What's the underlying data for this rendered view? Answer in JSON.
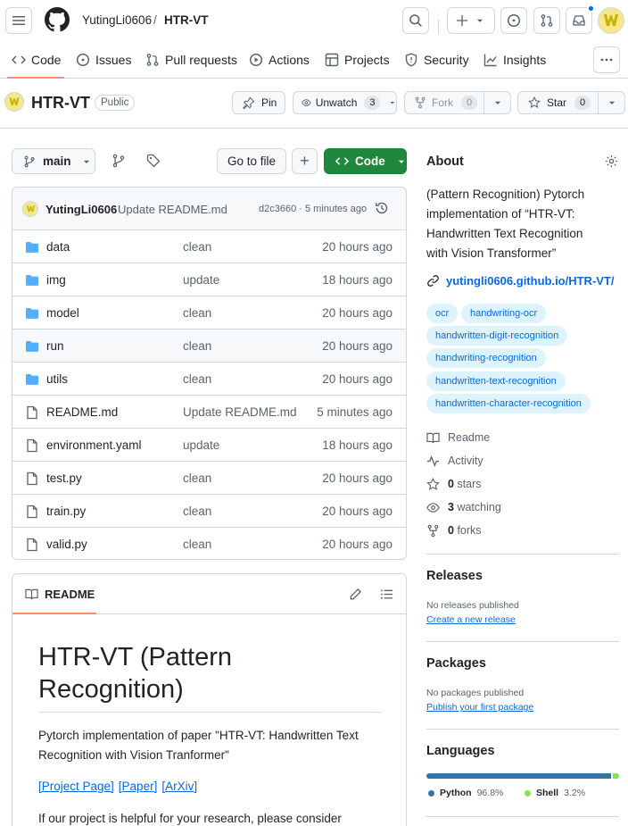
{
  "header": {
    "owner": "YutingLi0606",
    "separator": "/",
    "repo": "HTR-VT"
  },
  "repo_nav": {
    "tabs": [
      {
        "label": "Code",
        "icon": "code-icon"
      },
      {
        "label": "Issues",
        "icon": "issue-icon"
      },
      {
        "label": "Pull requests",
        "icon": "pull-request-icon"
      },
      {
        "label": "Actions",
        "icon": "play-icon"
      },
      {
        "label": "Projects",
        "icon": "table-icon"
      },
      {
        "label": "Security",
        "icon": "shield-icon"
      },
      {
        "label": "Insights",
        "icon": "graph-icon"
      }
    ],
    "active": "Code"
  },
  "repo_title": {
    "name": "HTR-VT",
    "visibility": "Public",
    "pin_label": "Pin",
    "unwatch_label": "Unwatch",
    "unwatch_count": "3",
    "fork_label": "Fork",
    "fork_count": "0",
    "star_label": "Star",
    "star_count": "0"
  },
  "toolbar": {
    "branch": "main",
    "go_to_file": "Go to file",
    "add_label": "+",
    "code_label": "Code"
  },
  "commit": {
    "author": "YutingLi0606",
    "message": "Update README.md",
    "meta": "d2c3660 · 5 minutes ago"
  },
  "files": [
    {
      "name": "data",
      "type": "folder",
      "message": "clean",
      "date": "20 hours ago"
    },
    {
      "name": "img",
      "type": "folder",
      "message": "update",
      "date": "18 hours ago"
    },
    {
      "name": "model",
      "type": "folder",
      "message": "clean",
      "date": "20 hours ago"
    },
    {
      "name": "run",
      "type": "folder",
      "message": "clean",
      "date": "20 hours ago"
    },
    {
      "name": "utils",
      "type": "folder",
      "message": "clean",
      "date": "20 hours ago"
    },
    {
      "name": "README.md",
      "type": "file",
      "message": "Update README.md",
      "date": "5 minutes ago"
    },
    {
      "name": "environment.yaml",
      "type": "file",
      "message": "update",
      "date": "18 hours ago"
    },
    {
      "name": "test.py",
      "type": "file",
      "message": "clean",
      "date": "20 hours ago"
    },
    {
      "name": "train.py",
      "type": "file",
      "message": "clean",
      "date": "20 hours ago"
    },
    {
      "name": "valid.py",
      "type": "file",
      "message": "clean",
      "date": "20 hours ago"
    }
  ],
  "readme": {
    "tab_label": "README",
    "title_line1": "HTR-VT (Pattern",
    "title_line2": "Recognition)",
    "paragraph_line1": "Pytorch implementation of paper \"HTR-VT: Handwritten Text",
    "paragraph_line2": "Recognition with Vision Tranformer\"",
    "links": [
      "[Project Page]",
      "[Paper]",
      "[ArXiv]"
    ],
    "paragraph2": "If our project is helpful for your research, please consider"
  },
  "about": {
    "heading": "About",
    "description_lines": [
      "(Pattern Recognition) Pytorch",
      "implementation of “HTR-VT:",
      "Handwritten Text Recognition",
      "with Vision Transformer”"
    ],
    "website": "yutingli0606.github.io/HTR-VT/",
    "topics": [
      "ocr",
      "handwriting-ocr",
      "handwritten-digit-recognition",
      "handwriting-recognition",
      "handwritten-text-recognition",
      "handwritten-character-recognition"
    ],
    "stats": [
      {
        "icon": "book-icon",
        "bold": "",
        "text": "Readme"
      },
      {
        "icon": "pulse-icon",
        "bold": "",
        "text": "Activity"
      },
      {
        "icon": "star-icon",
        "bold": "0",
        "text": "stars"
      },
      {
        "icon": "eye-icon",
        "bold": "3",
        "text": "watching"
      },
      {
        "icon": "fork-icon",
        "bold": "0",
        "text": "forks"
      }
    ]
  },
  "releases": {
    "heading": "Releases",
    "none_text": "No releases published",
    "create_link": "Create a new release"
  },
  "packages": {
    "heading": "Packages",
    "none_text": "No packages published",
    "publish_link": "Publish your first package"
  },
  "languages": {
    "heading": "Languages",
    "items": [
      {
        "name": "Python",
        "percent": "96.8%",
        "value": 96.8,
        "color": "#3572A5"
      },
      {
        "name": "Shell",
        "percent": "3.2%",
        "value": 3.2,
        "color": "#89e051"
      }
    ]
  }
}
